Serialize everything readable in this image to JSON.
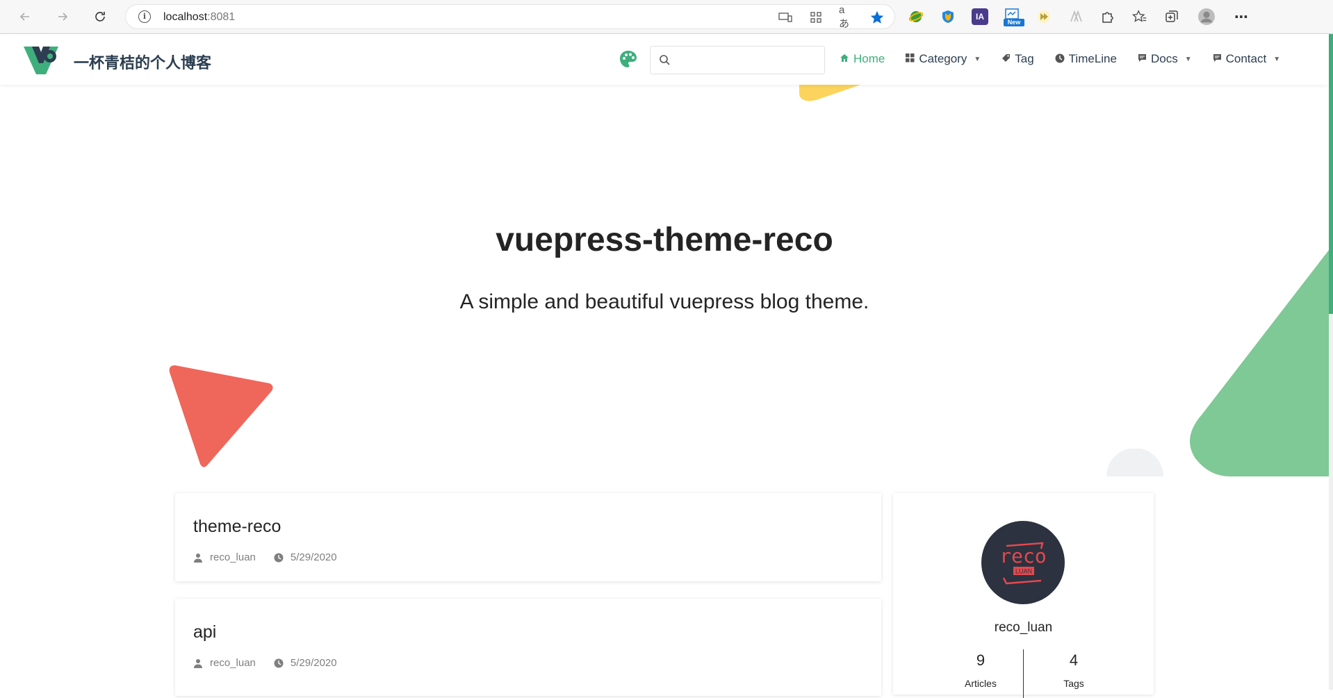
{
  "browser": {
    "url_host": "localhost",
    "url_port": ":8081",
    "ext_ia_label": "IA",
    "ext_new_label": "New"
  },
  "site": {
    "name": "一杯青桔的个人博客",
    "search_placeholder": "",
    "menu": [
      {
        "label": "Home",
        "icon": "home-icon",
        "active": true
      },
      {
        "label": "Category",
        "icon": "category-icon",
        "dropdown": true
      },
      {
        "label": "Tag",
        "icon": "tag-icon"
      },
      {
        "label": "TimeLine",
        "icon": "clock-icon"
      },
      {
        "label": "Docs",
        "icon": "message-icon",
        "dropdown": true
      },
      {
        "label": "Contact",
        "icon": "message-icon",
        "dropdown": true
      }
    ]
  },
  "hero": {
    "title": "vuepress-theme-reco",
    "description": "A simple and beautiful vuepress blog theme."
  },
  "posts": [
    {
      "title": "theme-reco",
      "author": "reco_luan",
      "date": "5/29/2020"
    },
    {
      "title": "api",
      "author": "reco_luan",
      "date": "5/29/2020"
    }
  ],
  "profile": {
    "name": "reco_luan",
    "avatar_text": "reco",
    "avatar_subtext": "LUAN",
    "articles_count": "9",
    "articles_label": "Articles",
    "tags_count": "4",
    "tags_label": "Tags"
  },
  "colors": {
    "accent": "#3eaf7c",
    "triangle_red": "#ef665b",
    "shape_green": "#7ec995",
    "shape_yellow": "#fcd35c",
    "avatar_bg": "#2c3240"
  }
}
